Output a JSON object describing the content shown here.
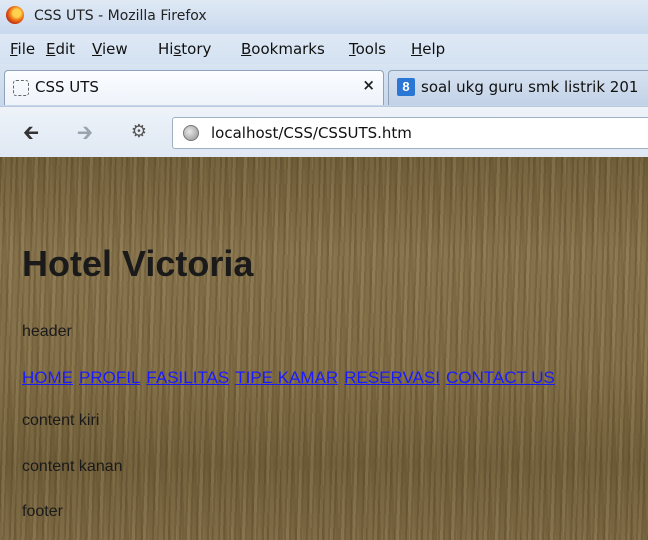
{
  "window": {
    "title": "CSS UTS - Mozilla Firefox"
  },
  "menu": {
    "items": [
      {
        "acc": "F",
        "rest": "ile"
      },
      {
        "acc": "E",
        "rest": "dit"
      },
      {
        "acc": "V",
        "rest": "iew"
      },
      {
        "pre": "Hi",
        "acc": "s",
        "rest": "tory"
      },
      {
        "acc": "B",
        "rest": "ookmarks"
      },
      {
        "acc": "T",
        "rest": "ools"
      },
      {
        "acc": "H",
        "rest": "elp"
      }
    ]
  },
  "tabs": [
    {
      "label": "CSS UTS",
      "close": "×",
      "icon": "blank-page-icon"
    },
    {
      "label": "soal ukg guru smk listrik 201",
      "icon": "google-icon",
      "icon_glyph": "8"
    }
  ],
  "navbar": {
    "url": "localhost/CSS/CSSUTS.htm",
    "back_glyph": "🡰",
    "forward_glyph": "🡲",
    "home_glyph": "⚙"
  },
  "page": {
    "title": "Hotel Victoria",
    "header_text": "header",
    "links": [
      "HOME",
      "PROFIL",
      "FASILITAS",
      "TIPE KAMAR",
      "RESERVASI",
      "CONTACT US"
    ],
    "content_left": "content kiri",
    "content_right": "content kanan",
    "footer_text": "footer"
  },
  "colors": {
    "link": "#1a1aff",
    "content_bg": "#7f6c45",
    "chrome_bg": "#dfe9f5"
  }
}
